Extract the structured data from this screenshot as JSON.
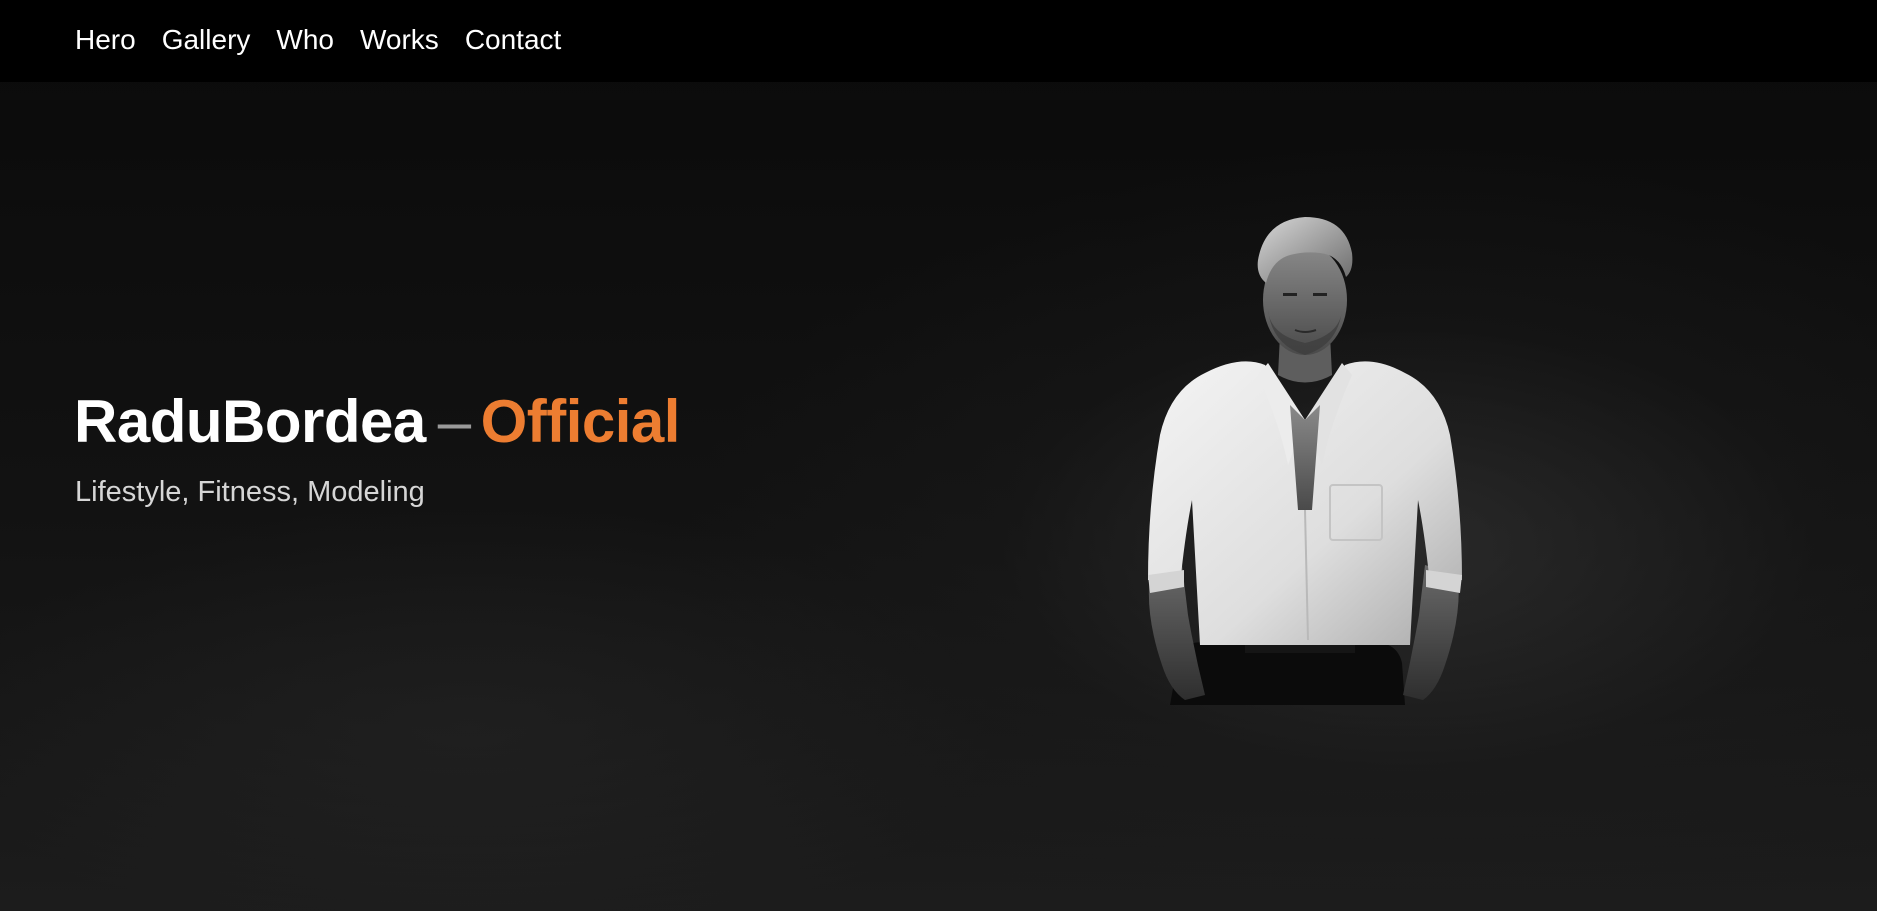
{
  "nav": {
    "items": [
      {
        "label": "Hero"
      },
      {
        "label": "Gallery"
      },
      {
        "label": "Who"
      },
      {
        "label": "Works"
      },
      {
        "label": "Contact"
      }
    ]
  },
  "hero": {
    "name": "RaduBordea",
    "dash": "–",
    "accent": "Official",
    "subtitle": "Lifestyle, Fitness, Modeling",
    "accent_color": "#ed7d31"
  },
  "portrait": {
    "icon": "portrait-image"
  }
}
